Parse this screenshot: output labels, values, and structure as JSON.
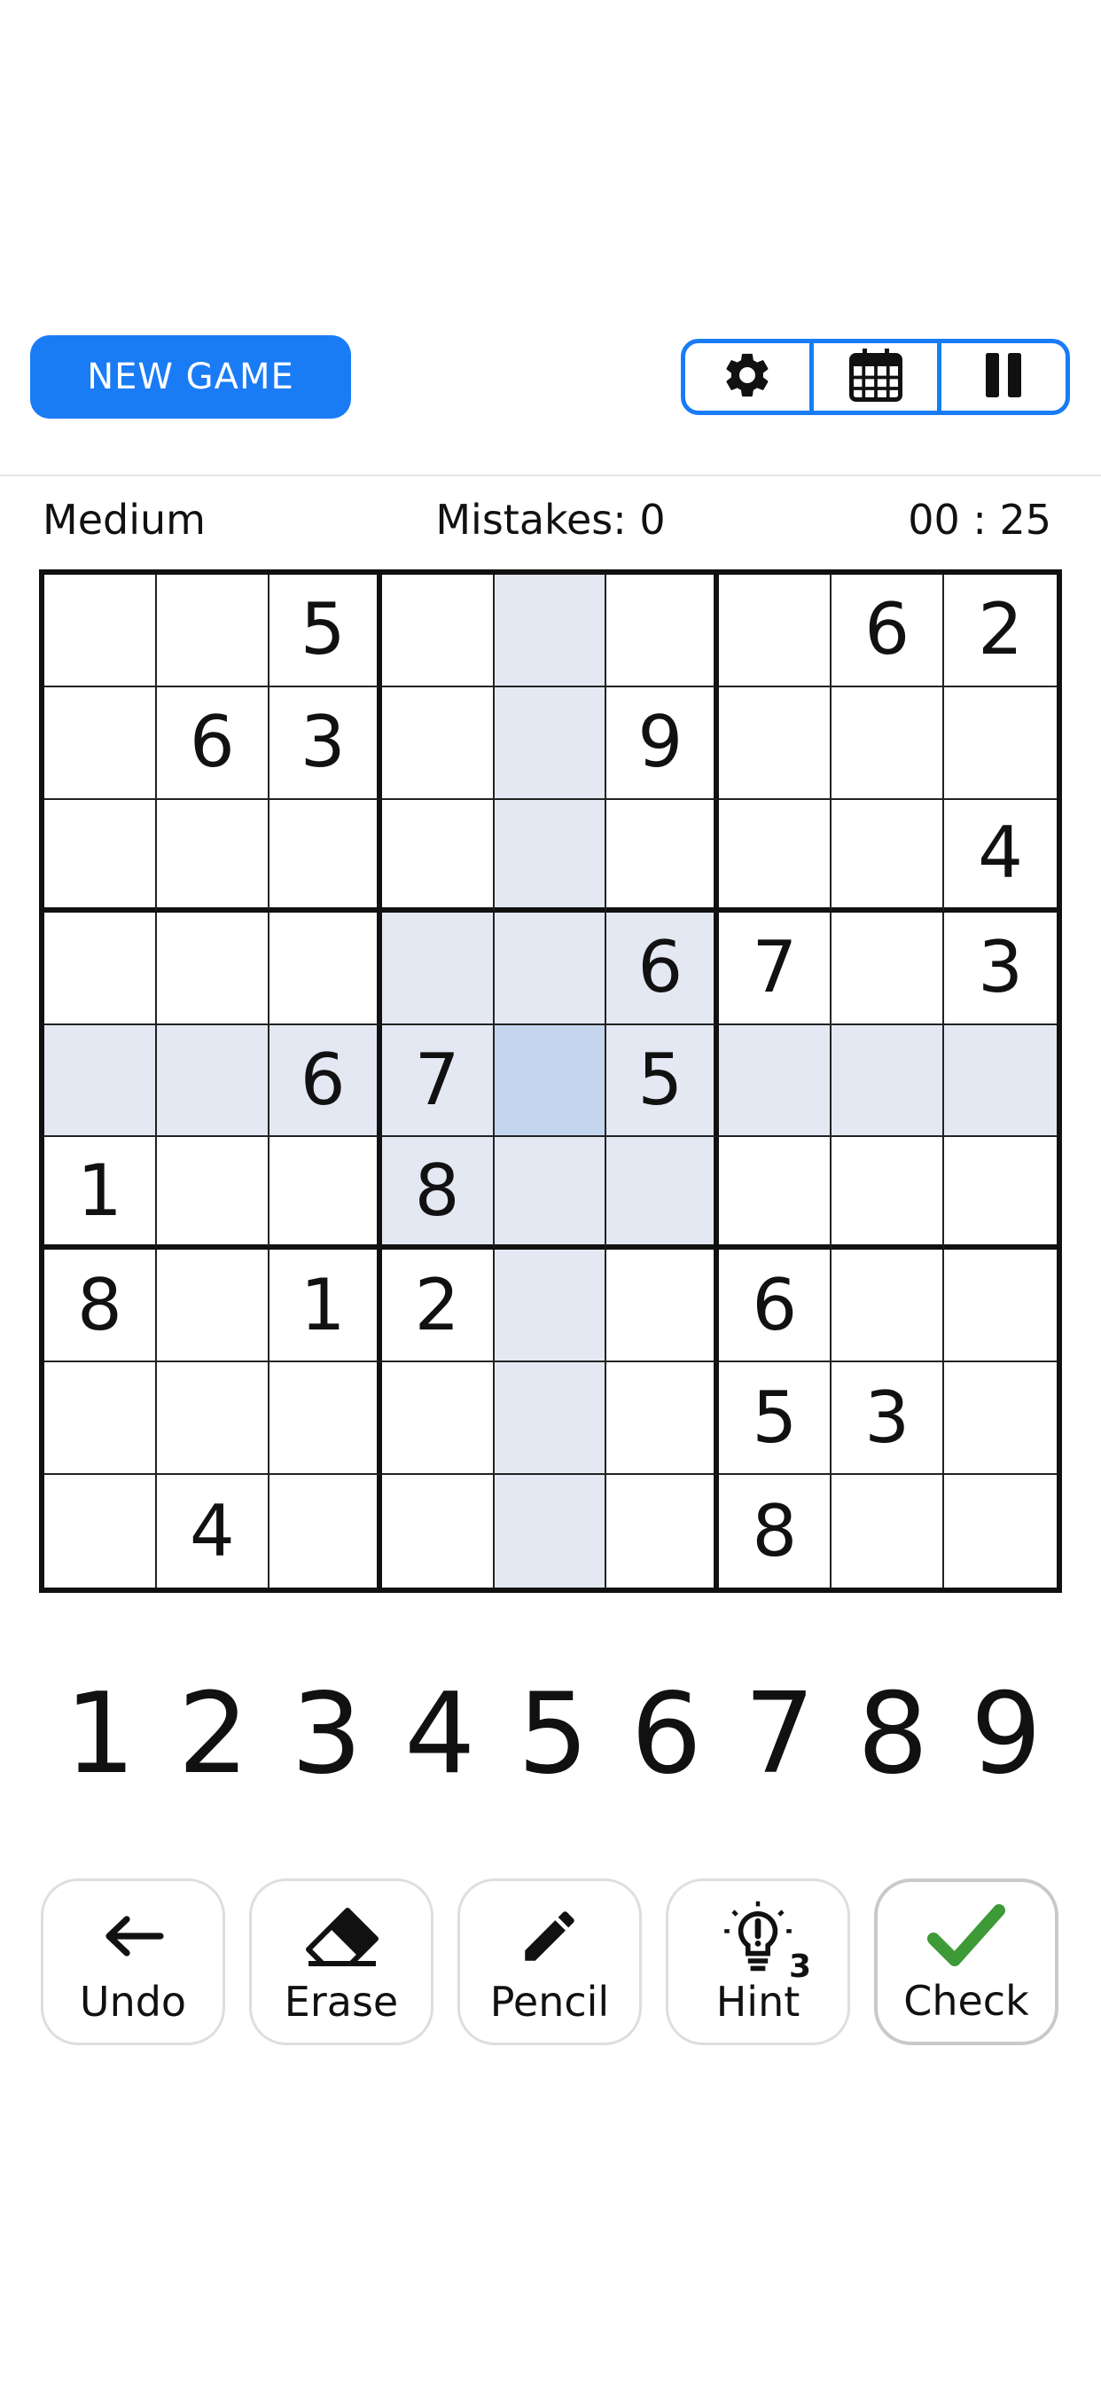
{
  "header": {
    "new_game_label": "NEW GAME",
    "tools": [
      {
        "icon": "gear-icon"
      },
      {
        "icon": "calendar-icon"
      },
      {
        "icon": "pause-icon"
      }
    ],
    "accent_color": "#1a7cf5"
  },
  "status": {
    "difficulty": "Medium",
    "mistakes": "Mistakes: 0",
    "timer": "00 : 25"
  },
  "board": {
    "selected": {
      "row": 4,
      "col": 4
    },
    "grid": [
      [
        "",
        "",
        "5",
        "",
        "",
        "",
        "",
        "6",
        "2"
      ],
      [
        "",
        "6",
        "3",
        "",
        "",
        "9",
        "",
        "",
        ""
      ],
      [
        "",
        "",
        "",
        "",
        "",
        "",
        "",
        "",
        "4"
      ],
      [
        "",
        "",
        "",
        "",
        "",
        "6",
        "7",
        "",
        "3"
      ],
      [
        "",
        "",
        "6",
        "7",
        "",
        "5",
        "",
        "",
        ""
      ],
      [
        "1",
        "",
        "",
        "8",
        "",
        "",
        "",
        "",
        ""
      ],
      [
        "8",
        "",
        "1",
        "2",
        "",
        "",
        "6",
        "",
        ""
      ],
      [
        "",
        "",
        "",
        "",
        "",
        "",
        "5",
        "3",
        ""
      ],
      [
        "",
        "4",
        "",
        "",
        "",
        "",
        "8",
        "",
        ""
      ]
    ],
    "highlight_color": "#e3e8f2",
    "selected_color": "#c4d5ee"
  },
  "numpad": [
    "1",
    "2",
    "3",
    "4",
    "5",
    "6",
    "7",
    "8",
    "9"
  ],
  "actions": {
    "undo": "Undo",
    "erase": "Erase",
    "pencil": "Pencil",
    "hint": "Hint",
    "hint_count": "3",
    "check": "Check"
  }
}
